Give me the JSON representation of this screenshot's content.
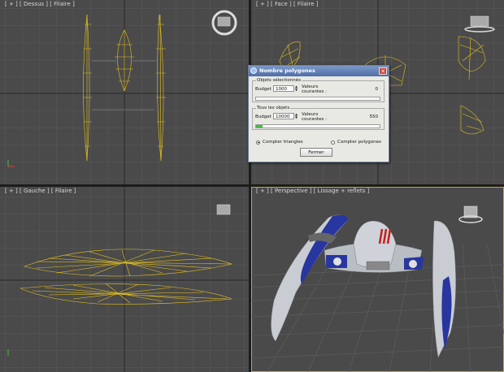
{
  "viewports": {
    "top": {
      "label": "[ + ] [ Dessus ] [ Filaire ]"
    },
    "front": {
      "label": "[ + ] [ Face ] [ Filaire ]"
    },
    "left": {
      "label": "[ + ] [ Gauche ] [ Filaire ]"
    },
    "perspective": {
      "label": "[ + ] [ Perspective ] [ Lissage + reflets ]"
    }
  },
  "dialog": {
    "title": "Nombre polygones",
    "close_glyph": "✕",
    "selected": {
      "group_title": "Objets sélectionnés",
      "budget_label": "Budget :",
      "budget_value": "1000",
      "current_label": "Valeurs courantes :",
      "current_value": "0",
      "fill_fraction": 0.0
    },
    "all": {
      "group_title": "Tous les objets",
      "budget_label": "Budget :",
      "budget_value": "10000",
      "current_label": "Valeurs courantes :",
      "current_value": "550",
      "fill_fraction": 0.055
    },
    "radio_triangles": "Compter triangles",
    "radio_polygons": "Compter polygones",
    "radio_selected": "triangles",
    "close_button": "Fermer"
  },
  "colors": {
    "viewport_bg": "#4a4a4a",
    "grid_line": "#5d5d5d",
    "wireframe": "#e6c21f",
    "active_border": "#c8a830",
    "ship_hull": "#c9ccd2",
    "ship_blue": "#2836a0"
  }
}
